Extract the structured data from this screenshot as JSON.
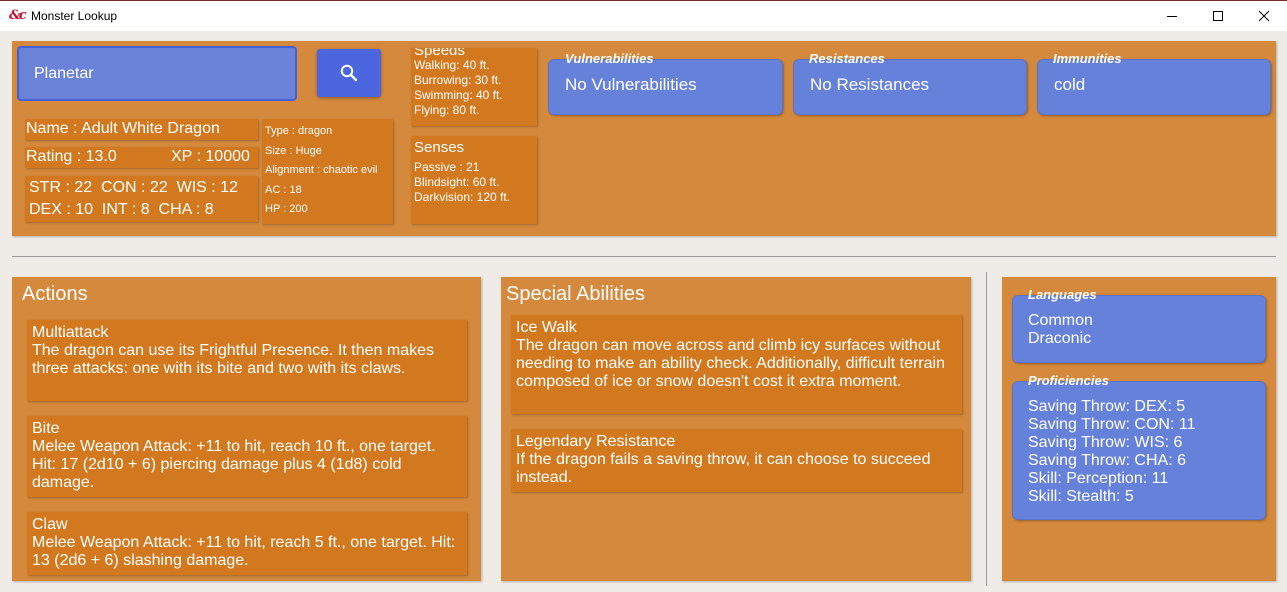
{
  "window": {
    "title": "Monster Lookup",
    "icon": "dnd-ampersand-icon"
  },
  "search": {
    "value": "Planetar",
    "button_icon": "search-icon"
  },
  "monster": {
    "name_line": "Name : Adult White Dragon",
    "rating_line": "Rating : 13.0",
    "xp_line": "XP : 10000",
    "abilities_line1": "STR : 22  CON : 22  WIS : 12",
    "abilities_line2": "DEX : 10  INT : 8  CHA : 8",
    "type": "Type : dragon",
    "size": "Size : Huge",
    "alignment": "Alignment : chaotic evil",
    "ac": "AC : 18",
    "hp": "HP : 200"
  },
  "speeds": {
    "header": "Speeds",
    "items": [
      "Walking: 40 ft.",
      "Burrowing: 30 ft.",
      "Swimming: 40 ft.",
      "Flying: 80 ft."
    ]
  },
  "senses": {
    "header": "Senses",
    "items": [
      "Passive : 21",
      "Blindsight: 60 ft.",
      "Darkvision: 120 ft."
    ]
  },
  "vulnerabilities": {
    "label": "Vulnerabilities",
    "value": "No Vulnerabilities"
  },
  "resistances": {
    "label": "Resistances",
    "value": "No Resistances"
  },
  "immunities": {
    "label": "Immunities",
    "value": "cold"
  },
  "actions": {
    "title": "Actions",
    "items": [
      {
        "name": "Multiattack",
        "desc": "The dragon can use its Frightful Presence. It then makes three attacks: one with its bite and two with its claws."
      },
      {
        "name": "Bite",
        "desc": "Melee Weapon Attack: +11 to hit, reach 10 ft., one target. Hit: 17 (2d10 + 6) piercing damage plus 4 (1d8) cold damage."
      },
      {
        "name": "Claw",
        "desc": "Melee Weapon Attack: +11 to hit, reach 5 ft., one target. Hit: 13 (2d6 + 6) slashing damage."
      }
    ]
  },
  "special_abilities": {
    "title": "Special Abilities",
    "items": [
      {
        "name": "Ice Walk",
        "desc": "The dragon can move across and climb icy surfaces without needing to make an ability check. Additionally, difficult terrain composed of ice or snow doesn't cost it extra moment."
      },
      {
        "name": "Legendary Resistance",
        "desc": "If the dragon fails a saving throw, it can choose to succeed instead."
      }
    ]
  },
  "languages": {
    "label": "Languages",
    "items": [
      "Common",
      "Draconic"
    ]
  },
  "proficiencies": {
    "label": "Proficiencies",
    "items": [
      "Saving Throw: DEX: 5",
      "Saving Throw: CON: 11",
      "Saving Throw: WIS: 6",
      "Saving Throw: CHA: 6",
      "Skill: Perception: 11",
      "Skill: Stealth: 5"
    ]
  },
  "colors": {
    "panel": "#d5893c",
    "box": "#d2781e",
    "blue": "#6681da",
    "button_blue": "#4b66df"
  }
}
